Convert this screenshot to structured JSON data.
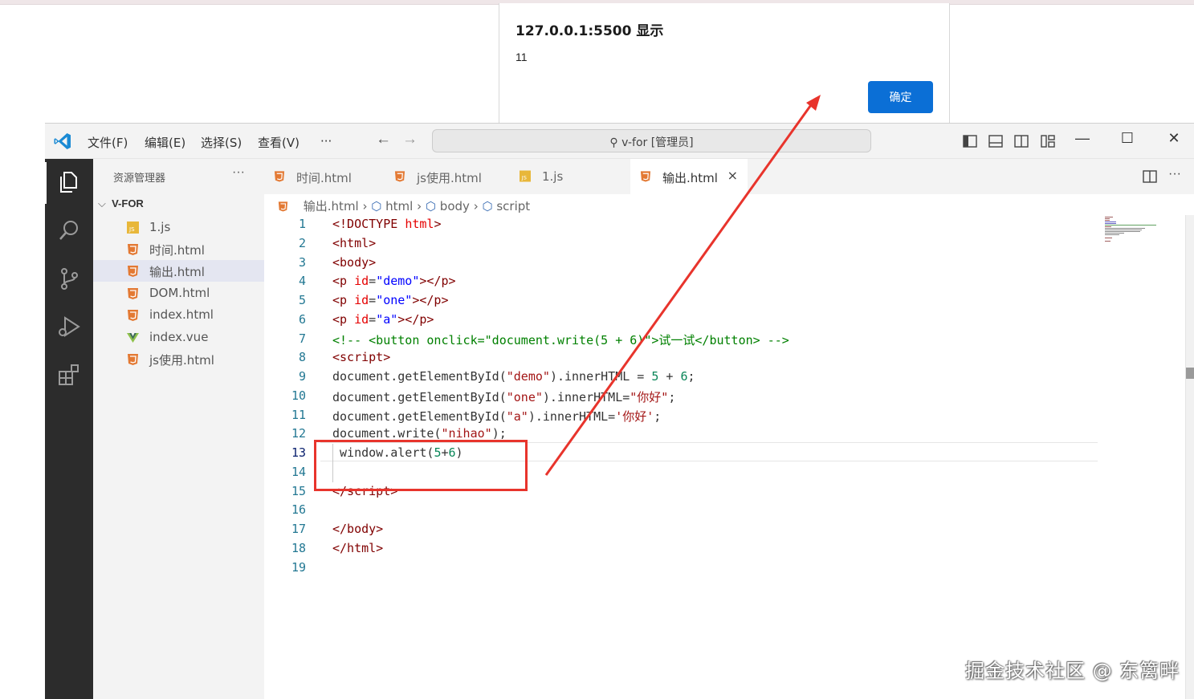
{
  "alert": {
    "title": "127.0.0.1:5500 显示",
    "message": "11",
    "ok_label": "确定"
  },
  "titlebar": {
    "menus": [
      "文件(F)",
      "编辑(E)",
      "选择(S)",
      "查看(V)",
      "···"
    ],
    "command_center": "v-for [管理员]"
  },
  "sidebar": {
    "title": "资源管理器",
    "more": "···",
    "folder": "V-FOR",
    "items": [
      {
        "label": "1.js",
        "icon": "js-file-icon"
      },
      {
        "label": "时间.html",
        "icon": "html-file-icon"
      },
      {
        "label": "输出.html",
        "icon": "html-file-icon",
        "selected": true
      },
      {
        "label": "DOM.html",
        "icon": "html-file-icon"
      },
      {
        "label": "index.html",
        "icon": "html-file-icon"
      },
      {
        "label": "index.vue",
        "icon": "vue-file-icon"
      },
      {
        "label": "js使用.html",
        "icon": "html-file-icon"
      }
    ]
  },
  "tabs": [
    {
      "label": "时间.html",
      "icon": "html-file-icon"
    },
    {
      "label": "js使用.html",
      "icon": "html-file-icon"
    },
    {
      "label": "1.js",
      "icon": "js-file-icon"
    },
    {
      "label": "输出.html",
      "icon": "html-file-icon",
      "active": true,
      "close": "×"
    }
  ],
  "breadcrumb": {
    "file": "输出.html",
    "parts": [
      "html",
      "body",
      "script"
    ]
  },
  "editor": {
    "line_numbers": [
      "1",
      "2",
      "3",
      "4",
      "5",
      "6",
      "7",
      "8",
      "9",
      "10",
      "11",
      "12",
      "13",
      "14",
      "15",
      "16",
      "17",
      "18",
      "19"
    ],
    "current_line": "13"
  },
  "watermark": "掘金技术社区 @ 东篱畔",
  "colors": {
    "accent": "#0b6fd6",
    "annotation": "#e8342c",
    "activity_bar": "#2c2c2c"
  }
}
